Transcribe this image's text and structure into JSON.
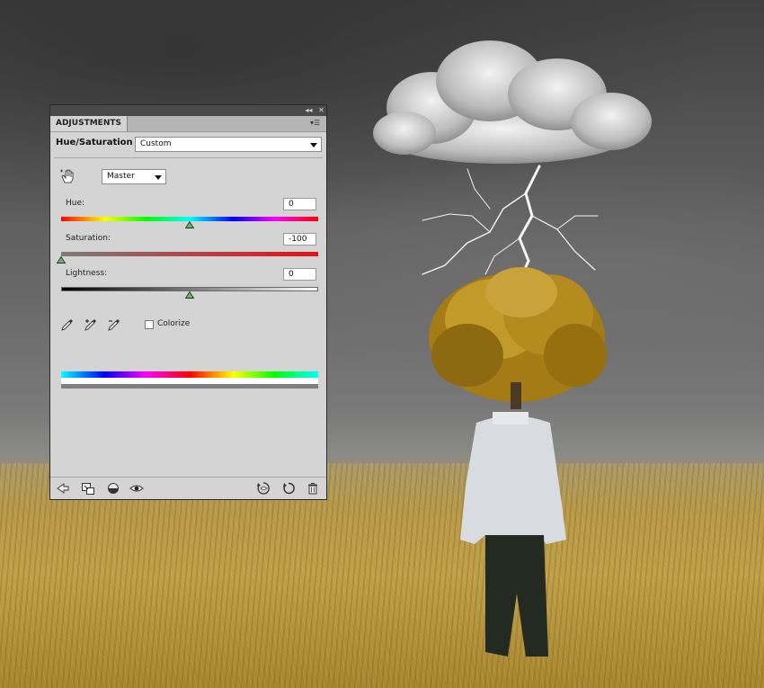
{
  "panel": {
    "tab_label": "ADJUSTMENTS",
    "title": "Hue/Saturation",
    "preset_value": "Custom",
    "channel_value": "Master"
  },
  "sliders": {
    "hue": {
      "label": "Hue:",
      "value": "0",
      "position": 0.5
    },
    "saturation": {
      "label": "Saturation:",
      "value": "-100",
      "position": 0.0
    },
    "lightness": {
      "label": "Lightness:",
      "value": "0",
      "position": 0.5
    }
  },
  "colorize": {
    "label": "Colorize",
    "checked": false
  },
  "icons": {
    "topbar": [
      "collapse-icon",
      "close-icon"
    ],
    "panel_menu": "panel-menu-icon",
    "tools": [
      "on-image-adjust-icon",
      "eyedropper-icon",
      "eyedropper-add-icon",
      "eyedropper-subtract-icon"
    ],
    "footer": [
      "back-arrow-icon",
      "clip-to-layer-icon",
      "layer-visibility-toggle-icon",
      "eye-icon",
      "view-previous-state-icon",
      "reset-icon",
      "trash-icon"
    ]
  },
  "colors": {
    "panel_bg": "#d4d4d4",
    "topbar": "#4a4a4a",
    "saturation_track_end": "#e8101a"
  }
}
